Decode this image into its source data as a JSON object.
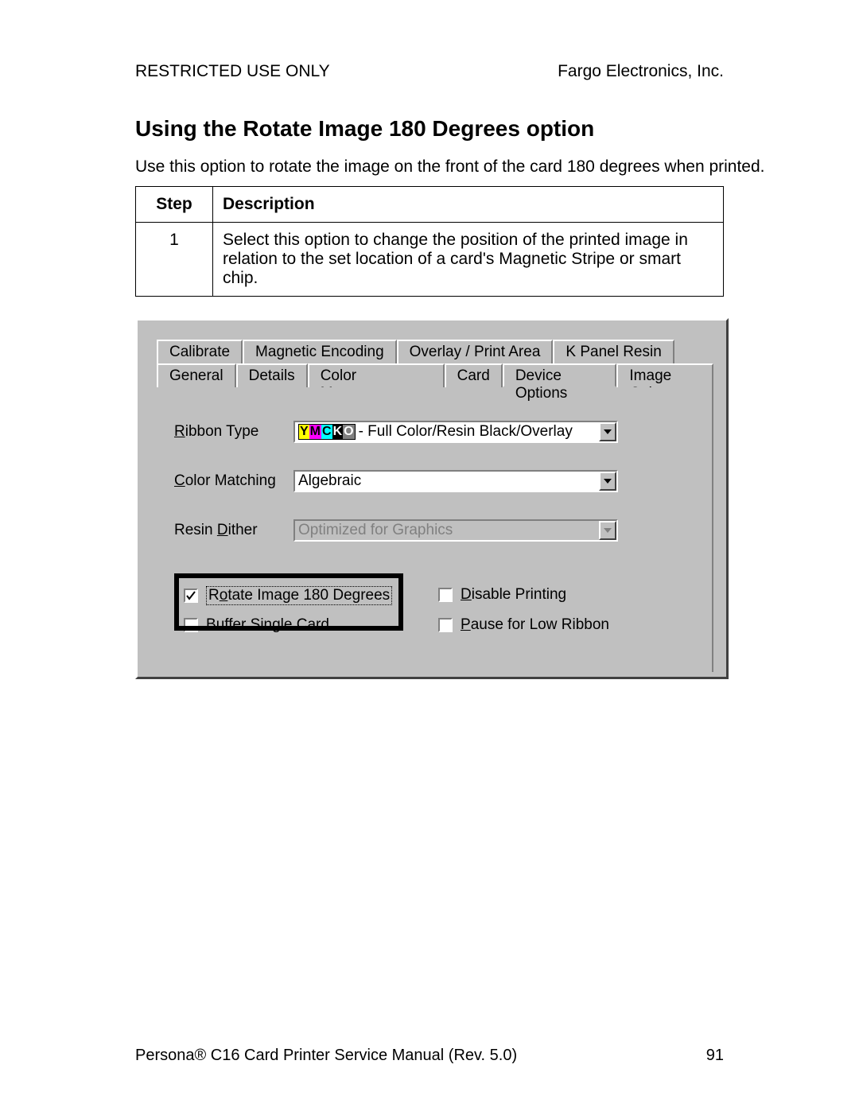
{
  "header": {
    "left": "RESTRICTED USE ONLY",
    "right": "Fargo Electronics, Inc."
  },
  "section": {
    "title": "Using the Rotate Image 180 Degrees option",
    "para": "Use this option to rotate the image on the front of the card 180 degrees when printed."
  },
  "table": {
    "head_step": "Step",
    "head_desc": "Description",
    "rows": [
      {
        "step": "1",
        "desc": "Select this option to change the position of the printed image in relation to the set location of a card's Magnetic Stripe or smart chip."
      }
    ]
  },
  "dialog": {
    "tabs_row1": [
      "Calibrate",
      "Magnetic Encoding",
      "Overlay / Print Area",
      "K Panel Resin"
    ],
    "tabs_row2": [
      "General",
      "Details",
      "Color Management",
      "Card",
      "Device Options",
      "Image Color"
    ],
    "active_tab": "Device Options",
    "labels": {
      "ribbon": "Ribbon Type",
      "color": "Color Matching",
      "dither": "Resin Dither"
    },
    "ribbon_value_suffix": " - Full Color/Resin Black/Overlay",
    "color_value": "Algebraic",
    "dither_value": "Optimized for Graphics",
    "check": {
      "rotate": "Rotate Image 180 Degrees",
      "buffer": "Buffer Single Card",
      "disable": "Disable Printing",
      "pause": "Pause for Low Ribbon"
    }
  },
  "footer": {
    "left": "Persona® C16 Card Printer Service Manual (Rev. 5.0)",
    "right": "91"
  }
}
